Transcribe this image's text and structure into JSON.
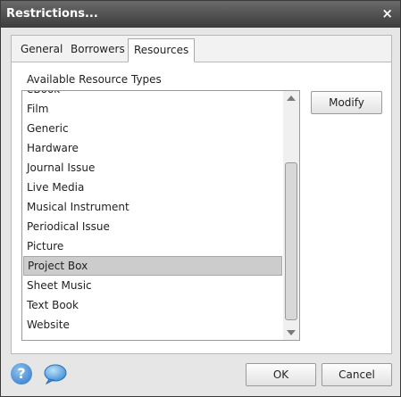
{
  "dialog": {
    "title": "Restrictions...",
    "close": "×"
  },
  "tabs": [
    {
      "label": "General"
    },
    {
      "label": "Borrowers"
    },
    {
      "label": "Resources"
    }
  ],
  "section_label": "Available Resource Types",
  "list": {
    "items": [
      "eBook",
      "Film",
      "Generic",
      "Hardware",
      "Journal Issue",
      "Live Media",
      "Musical Instrument",
      "Periodical Issue",
      "Picture",
      "Project Box",
      "Sheet Music",
      "Text Book",
      "Website"
    ],
    "selected": "Project Box"
  },
  "buttons": {
    "modify": "Modify",
    "ok": "OK",
    "cancel": "Cancel"
  },
  "icons": {
    "help": "?",
    "help_name": "help-icon",
    "chat_name": "chat-icon"
  },
  "colors": {
    "titlebar": "#4a4a4a",
    "selected_row": "#cccccc",
    "help_icon": "#2a73c4"
  }
}
